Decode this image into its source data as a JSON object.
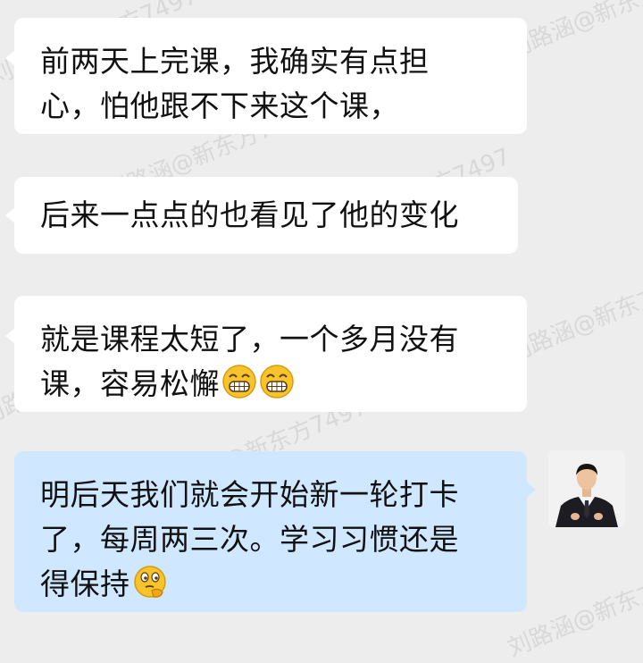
{
  "watermark": {
    "text": "刘路涵@新东方7497"
  },
  "messages": [
    {
      "sender": "other",
      "lines": [
        "前两天上完课，我确实有点担",
        "心，怕他跟不下来这个课，"
      ]
    },
    {
      "sender": "other",
      "lines": [
        "后来一点点的也看见了他的变化"
      ]
    },
    {
      "sender": "other",
      "lines": [
        "就是课程太短了，一个多月没有",
        "课，容易松懈"
      ],
      "emojis": [
        "grinning-face-emoji",
        "grinning-face-emoji"
      ]
    },
    {
      "sender": "self",
      "lines": [
        "明后天我们就会开始新一轮打卡",
        "了，每周两三次。学习习惯还是",
        "得保持"
      ],
      "emojis": [
        "thinking-face-emoji"
      ]
    }
  ],
  "colors": {
    "background": "#ededed",
    "incoming_bubble": "#ffffff",
    "outgoing_bubble": "#cfe8ff",
    "text": "#111111"
  },
  "avatar": {
    "icon": "user-avatar-man-in-suit"
  }
}
